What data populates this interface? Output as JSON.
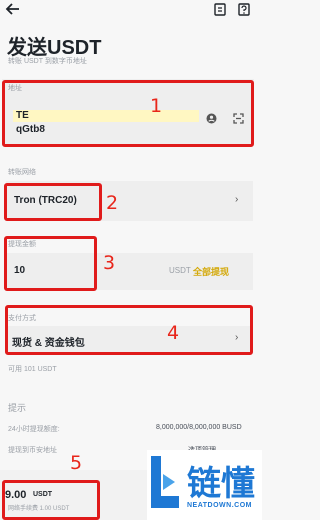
{
  "header": {
    "back_icon": "arrow-left-icon",
    "icons": [
      "history-icon",
      "help-icon"
    ],
    "title": "发送USDT",
    "subtitle": "转账 USDT 到数字币地址"
  },
  "address": {
    "label": "地址",
    "line1": "TE",
    "line2": "qGtb8",
    "highlight_color": "#fff7c2",
    "address_book_icon": "address-book-icon",
    "scan_icon": "scan-icon",
    "marker": "1"
  },
  "network": {
    "label": "转账网络",
    "value": "Tron (TRC20)",
    "marker": "2"
  },
  "amount": {
    "label": "提现金额",
    "value": "10",
    "unit": "USDT",
    "max_label": "全部提现",
    "max_color": "#d4a90a",
    "marker": "3"
  },
  "payment": {
    "label": "支付方式",
    "value": "现货 & 资金钱包",
    "available": "可用 101 USDT",
    "marker": "4"
  },
  "tips": {
    "title": "提示",
    "limit_label": "24小时提现额度:",
    "limit_value": "8,000,000/8,000,000 BUSD",
    "change_label": "提现到币安地址",
    "change_value": "选项管理"
  },
  "bottom": {
    "fee_value": "9.00",
    "fee_unit": "USDT",
    "fee_sub": "网络手续费 1.00 USDT",
    "marker": "5"
  },
  "watermark": {
    "text": "链懂",
    "url": "NEATDOWN.COM"
  },
  "colors": {
    "accent_red": "#e01b1b",
    "gold": "#d4a90a"
  }
}
